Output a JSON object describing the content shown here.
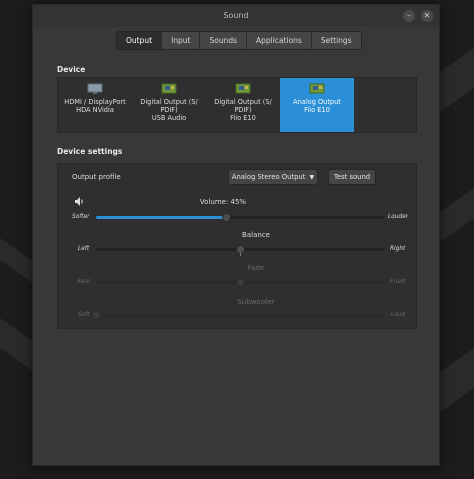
{
  "window": {
    "title": "Sound",
    "minimize_glyph": "–",
    "close_glyph": "✕"
  },
  "tabs": [
    {
      "label": "Output",
      "active": true
    },
    {
      "label": "Input",
      "active": false
    },
    {
      "label": "Sounds",
      "active": false
    },
    {
      "label": "Applications",
      "active": false
    },
    {
      "label": "Settings",
      "active": false
    }
  ],
  "device_section": {
    "title": "Device",
    "devices": [
      {
        "line1": "HDMI / DisplayPort",
        "line2": "HDA NVidia",
        "line3": "",
        "icon": "monitor-icon",
        "selected": false
      },
      {
        "line1": "Digital Output (S/",
        "line2": "PDIF)",
        "line3": "USB Audio",
        "icon": "sound-card-icon",
        "selected": false
      },
      {
        "line1": "Digital Output (S/",
        "line2": "PDIF)",
        "line3": "Fiio E10",
        "icon": "sound-card-icon",
        "selected": false
      },
      {
        "line1": "Analog Output",
        "line2": "Fiio E10",
        "line3": "",
        "icon": "sound-card-icon",
        "selected": true
      }
    ]
  },
  "settings_section": {
    "title": "Device settings",
    "output_profile_label": "Output profile",
    "profile_value": "Analog Stereo Output",
    "test_sound_label": "Test sound",
    "volume": {
      "label": "Volume: 45%",
      "left": "Softer",
      "right": "Louder",
      "fraction": 0.45
    },
    "balance": {
      "label": "Balance",
      "left": "Left",
      "right": "Right",
      "fraction": 0.5
    },
    "fade": {
      "label": "Fade",
      "left": "Rear",
      "right": "Front",
      "fraction": 0.5
    },
    "subwoofer": {
      "label": "Subwoofer",
      "left": "Soft",
      "right": "Loud",
      "fraction": 0.0
    }
  },
  "colors": {
    "accent": "#2a8fd6",
    "window_bg": "#383838",
    "panel_bg": "#2f2f2f"
  }
}
